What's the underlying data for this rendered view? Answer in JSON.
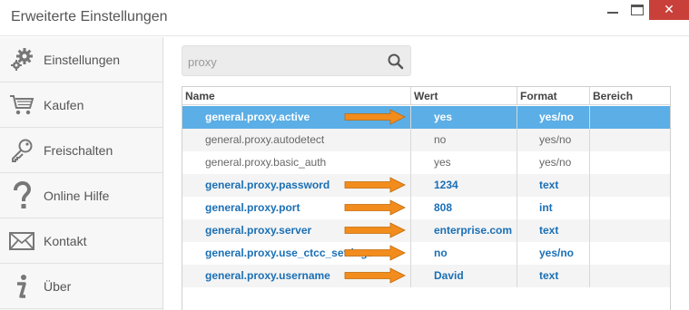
{
  "window": {
    "title": "Erweiterte Einstellungen",
    "close_glyph": "✕"
  },
  "sidebar": {
    "items": [
      {
        "label": "Einstellungen",
        "icon": "gear-icon"
      },
      {
        "label": "Kaufen",
        "icon": "cart-icon"
      },
      {
        "label": "Freischalten",
        "icon": "key-icon"
      },
      {
        "label": "Online Hilfe",
        "icon": "question-icon"
      },
      {
        "label": "Kontakt",
        "icon": "envelope-icon"
      },
      {
        "label": "Über",
        "icon": "info-icon"
      }
    ]
  },
  "search": {
    "value": "proxy",
    "icon": "search-icon"
  },
  "table": {
    "headers": {
      "name": "Name",
      "value": "Wert",
      "format": "Format",
      "range": "Bereich"
    },
    "rows": [
      {
        "name": "general.proxy.active",
        "value": "yes",
        "format": "yes/no",
        "range": "",
        "state": "selected",
        "highlighted_by_arrow": true
      },
      {
        "name": "general.proxy.autodetect",
        "value": "no",
        "format": "yes/no",
        "range": "",
        "state": "default",
        "highlighted_by_arrow": false
      },
      {
        "name": "general.proxy.basic_auth",
        "value": "yes",
        "format": "yes/no",
        "range": "",
        "state": "default",
        "highlighted_by_arrow": false
      },
      {
        "name": "general.proxy.password",
        "value": "1234",
        "format": "text",
        "range": "",
        "state": "modified",
        "highlighted_by_arrow": true
      },
      {
        "name": "general.proxy.port",
        "value": "808",
        "format": "int",
        "range": "",
        "state": "modified",
        "highlighted_by_arrow": true
      },
      {
        "name": "general.proxy.server",
        "value": "enterprise.com",
        "format": "text",
        "range": "",
        "state": "modified",
        "highlighted_by_arrow": true
      },
      {
        "name": "general.proxy.use_ctcc_settings",
        "value": "no",
        "format": "yes/no",
        "range": "",
        "state": "modified",
        "highlighted_by_arrow": true
      },
      {
        "name": "general.proxy.username",
        "value": "David",
        "format": "text",
        "range": "",
        "state": "modified",
        "highlighted_by_arrow": true
      }
    ]
  },
  "colors": {
    "selection": "#5baee6",
    "modified_text": "#1a6fb5",
    "arrow": "#f28c1c",
    "close_button": "#c9403a"
  }
}
